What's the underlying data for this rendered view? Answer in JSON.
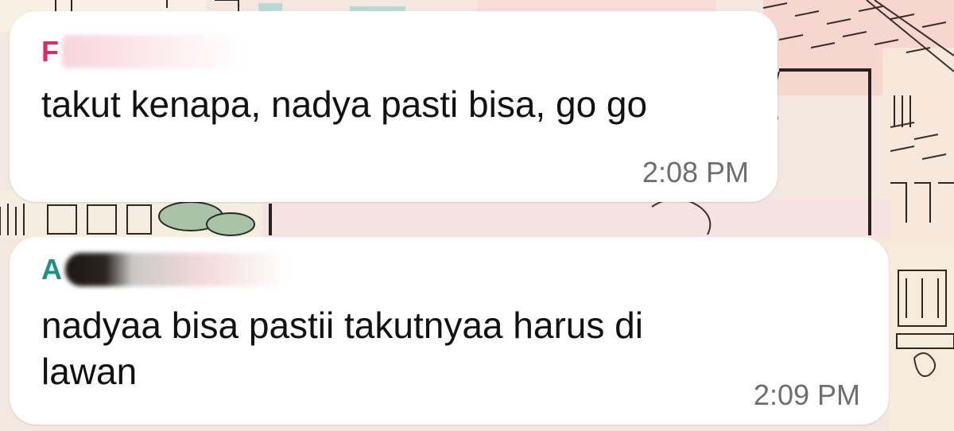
{
  "colors": {
    "sender_1": "#e0286a",
    "sender_2": "#1e8f84",
    "bubble": "#ffffff",
    "message_text": "#111111",
    "timestamp": "#6e6e6e",
    "wallpaper": "#f4e7df"
  },
  "messages": [
    {
      "sender_visible": "F",
      "lines": [
        "takut kenapa, nadya pasti bisa, go go"
      ],
      "time": "2:08 PM"
    },
    {
      "sender_visible": "A",
      "lines": [
        "nadyaa bisa pastii takutnyaa harus di",
        "lawan"
      ],
      "time": "2:09 PM"
    }
  ]
}
